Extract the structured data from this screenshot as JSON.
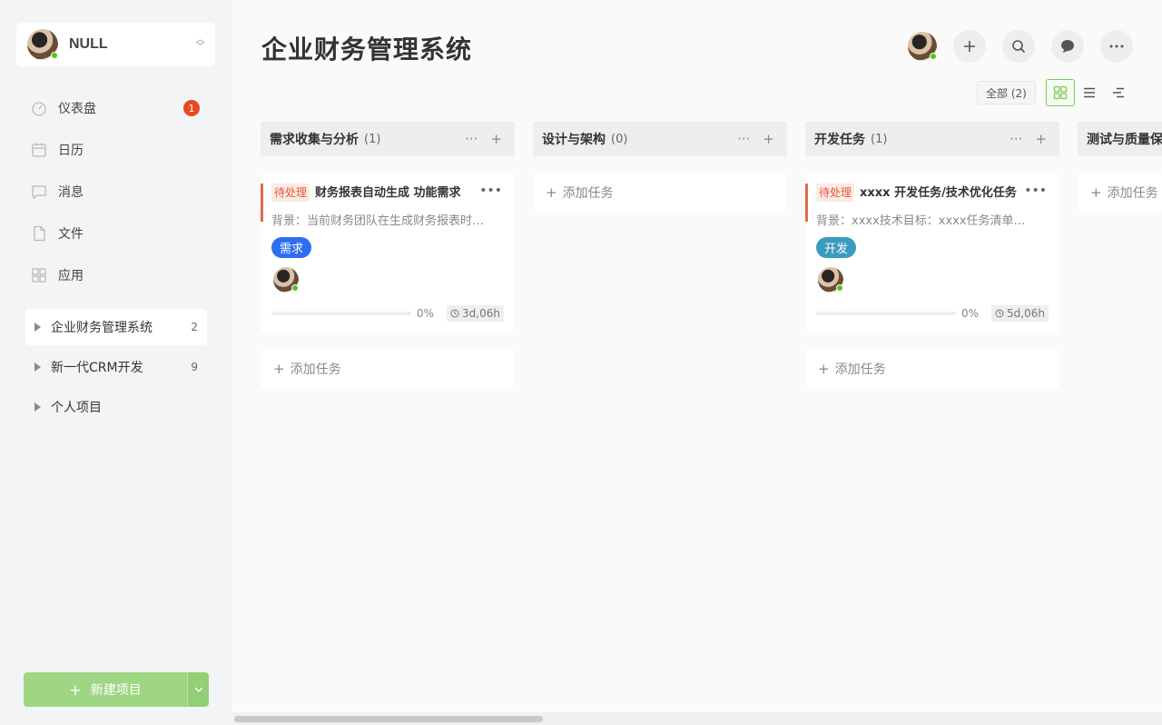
{
  "account": {
    "name": "NULL"
  },
  "nav": [
    {
      "label": "仪表盘",
      "icon": "dashboard-icon",
      "badge": "1"
    },
    {
      "label": "日历",
      "icon": "calendar-icon"
    },
    {
      "label": "消息",
      "icon": "message-icon"
    },
    {
      "label": "文件",
      "icon": "file-icon"
    },
    {
      "label": "应用",
      "icon": "apps-icon"
    }
  ],
  "projects": [
    {
      "name": "企业财务管理系统",
      "count": "2"
    },
    {
      "name": "新一代CRM开发",
      "count": "9"
    },
    {
      "name": "个人项目",
      "count": ""
    }
  ],
  "new_project_label": "新建项目",
  "page_title": "企业财务管理系统",
  "filter_label": "全部 (2)",
  "add_task_label": "添加任务",
  "columns": [
    {
      "name": "需求收集与分析",
      "count": "(1)",
      "card": {
        "status": "待处理",
        "title": "财务报表自动生成 功能需求",
        "desc": "背景：当前财务团队在生成财务报表时…",
        "tag": "需求",
        "tag_color": "#2f6ef0",
        "progress": "0%",
        "progress_value": 0,
        "time": "3d,06h"
      }
    },
    {
      "name": "设计与架构",
      "count": "(0)"
    },
    {
      "name": "开发任务",
      "count": "(1)",
      "card": {
        "status": "待处理",
        "title": "xxxx 开发任务/技术优化任务",
        "desc": "背景：xxxx技术目标：xxxx任务清单…",
        "tag": "开发",
        "tag_color": "#3a9bbf",
        "progress": "0%",
        "progress_value": 0,
        "time": "5d,06h"
      }
    },
    {
      "name": "测试与质量保",
      "count": ""
    }
  ],
  "colors": {
    "accent": "#7cc85a",
    "badge": "#e8491d",
    "status": "#e05a3b"
  }
}
